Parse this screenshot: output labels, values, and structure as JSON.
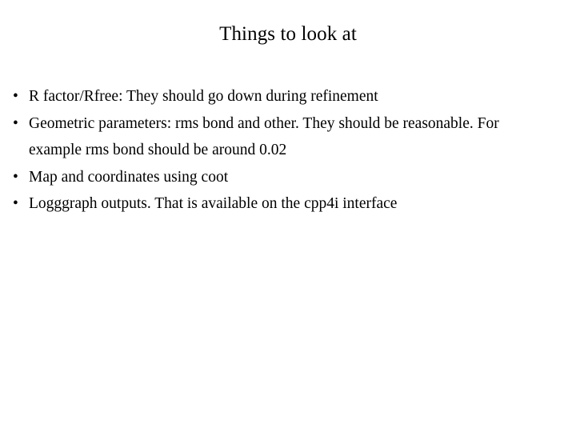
{
  "slide": {
    "title": "Things to look at",
    "background_color": "#ffffff",
    "text_color": "#000000",
    "bullet_glyph": "•",
    "bullets": [
      {
        "text": "R factor/Rfree: They should go down during refinement"
      },
      {
        "text": "Geometric parameters: rms bond and other. They should be reasonable. For example rms bond should be around 0.02"
      },
      {
        "text": "Map and coordinates using coot"
      },
      {
        "text": "Logggraph outputs. That is available on the cpp4i interface"
      }
    ]
  }
}
